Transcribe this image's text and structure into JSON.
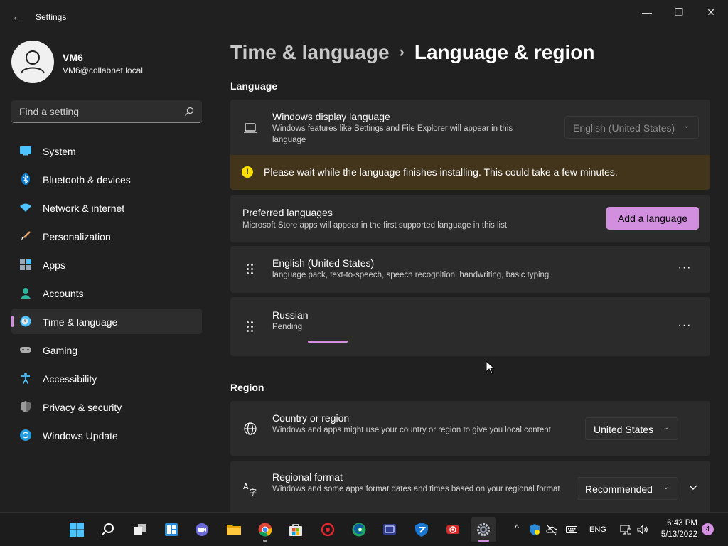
{
  "window": {
    "title": "Settings",
    "back_glyph": "←",
    "minimize_glyph": "—",
    "maximize_glyph": "❐",
    "close_glyph": "✕"
  },
  "user": {
    "name": "VM6",
    "email": "VM6@collabnet.local"
  },
  "search": {
    "placeholder": "Find a setting"
  },
  "sidebar": {
    "items": [
      {
        "label": "System",
        "icon": "monitor-icon"
      },
      {
        "label": "Bluetooth & devices",
        "icon": "bluetooth-icon"
      },
      {
        "label": "Network & internet",
        "icon": "wifi-icon"
      },
      {
        "label": "Personalization",
        "icon": "brush-icon"
      },
      {
        "label": "Apps",
        "icon": "apps-icon"
      },
      {
        "label": "Accounts",
        "icon": "person-icon"
      },
      {
        "label": "Time & language",
        "icon": "clock-globe-icon",
        "active": true
      },
      {
        "label": "Gaming",
        "icon": "controller-icon"
      },
      {
        "label": "Accessibility",
        "icon": "accessibility-icon"
      },
      {
        "label": "Privacy & security",
        "icon": "shield-icon"
      },
      {
        "label": "Windows Update",
        "icon": "update-icon"
      }
    ]
  },
  "breadcrumb": {
    "parent": "Time & language",
    "separator": "›",
    "current": "Language & region"
  },
  "language_section": {
    "title": "Language",
    "display_language": {
      "title": "Windows display language",
      "desc": "Windows features like Settings and File Explorer will appear in this language",
      "dropdown_value": "English (United States)"
    },
    "warning": {
      "icon_glyph": "!",
      "text": "Please wait while the language finishes installing. This could take a few minutes."
    },
    "preferred": {
      "title": "Preferred languages",
      "desc": "Microsoft Store apps will appear in the first supported language in this list",
      "add_button": "Add a language"
    },
    "languages": [
      {
        "name": "English (United States)",
        "detail": "language pack, text-to-speech, speech recognition, handwriting, basic typing"
      },
      {
        "name": "Russian",
        "detail": "Pending",
        "progress": 0.5
      }
    ],
    "more_glyph": "···"
  },
  "region_section": {
    "title": "Region",
    "country": {
      "title": "Country or region",
      "desc": "Windows and apps might use your country or region to give you local content",
      "dropdown_value": "United States"
    },
    "format": {
      "title": "Regional format",
      "desc": "Windows and some apps format dates and times based on your regional format",
      "dropdown_value": "Recommended"
    },
    "chevron_glyph": "⌄"
  },
  "taskbar": {
    "apps": [
      "start-icon",
      "search-icon",
      "task-view-icon",
      "widgets-icon",
      "chat-icon",
      "file-explorer-icon",
      "chrome-icon",
      "store-icon",
      "app-red-icon",
      "edge-icon",
      "remote-icon",
      "defender-icon",
      "recorder-icon",
      "settings-icon"
    ],
    "tray": {
      "chevron": "^",
      "language": "ENG",
      "time": "6:43 PM",
      "date": "5/13/2022",
      "notifications": "4"
    }
  },
  "colors": {
    "accent": "#d28fdf",
    "background": "#202020",
    "card": "#2b2b2b",
    "warning_bg": "#43351c",
    "warning_icon": "#fce100"
  }
}
